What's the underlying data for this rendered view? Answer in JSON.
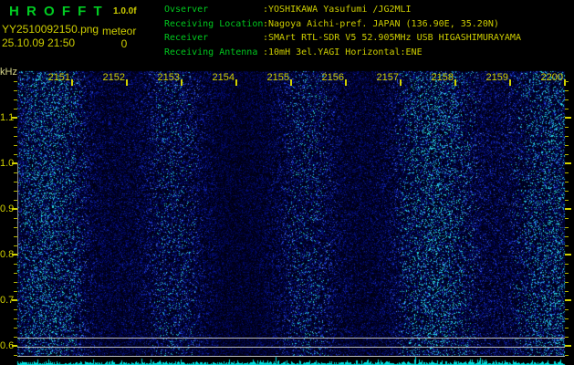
{
  "app": {
    "title": "H R O F F T",
    "version": "1.0.0f",
    "filename": "YY2510092150.png",
    "mode": "meteor",
    "datetime": "25.10.09 21:50",
    "meteor_count": "0"
  },
  "info_rows": [
    {
      "label": "Ovserver",
      "value": ":YOSHIKAWA Yasufumi /JG2MLI"
    },
    {
      "label": "Receiving Location",
      "value": ":Nagoya Aichi-pref. JAPAN (136.90E, 35.20N)"
    },
    {
      "label": "Receiver",
      "value": ":SMArt RTL-SDR V5 52.905MHz USB HIGASHIMURAYAMA"
    },
    {
      "label": "Receiving Antenna",
      "value": ":10mH 3el.YAGI Horizontal:ENE"
    }
  ],
  "axes": {
    "freq_unit_label": "kHz",
    "freq_tick_labels": [
      "1.1",
      "1.0",
      "0.9",
      "0.8",
      "0.7",
      "0.6"
    ],
    "time_tick_labels": [
      "2151",
      "2152",
      "2153",
      "2154",
      "2155",
      "2156",
      "2157",
      "2158",
      "2159",
      "2200"
    ]
  },
  "colors": {
    "title_green": "#00cc22",
    "label_green": "#00c81e",
    "value_yellow": "#cdcd00",
    "axis_yellow": "#d2d200",
    "unit_label": "#d8d88c",
    "grid_gray": "#b9b9b9",
    "strip_cyan": "#00dcdc",
    "noise_blue": "#1020a0"
  }
}
